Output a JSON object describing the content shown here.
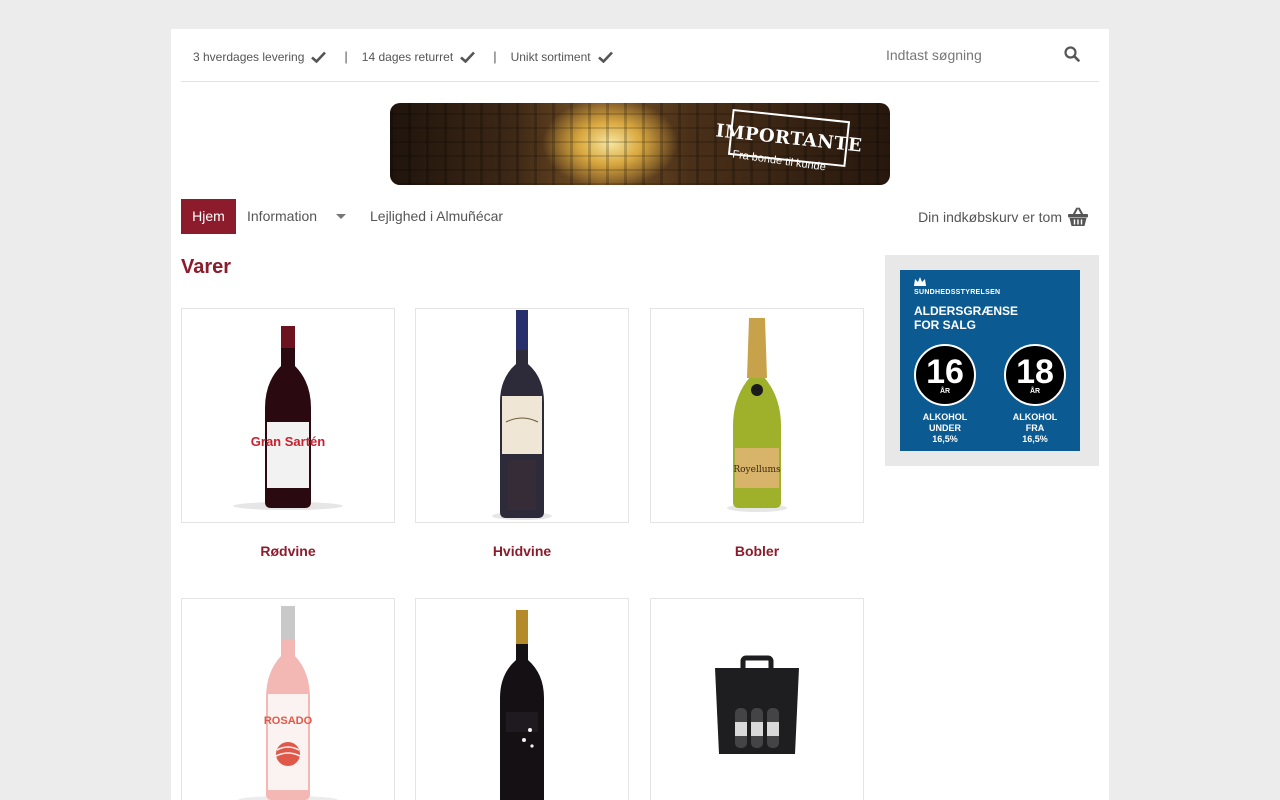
{
  "topbar": {
    "usps": [
      "3 hverdages levering",
      "14 dages returret",
      "Unikt sortiment"
    ],
    "search_placeholder": "Indtast søgning"
  },
  "banner": {
    "logo_title": "IMPORTANTE",
    "logo_subtitle": "Fra bonde til kunde"
  },
  "nav": {
    "home": "Hjem",
    "information": "Information",
    "apartment": "Lejlighed i Almuñécar",
    "cart": "Din indkøbskurv er tom"
  },
  "main": {
    "heading": "Varer",
    "products": [
      {
        "name": "Rødvine",
        "label": "Gran Sartén"
      },
      {
        "name": "Hvidvine",
        "label": ""
      },
      {
        "name": "Bobler",
        "label": "Royellums"
      },
      {
        "name": "",
        "label": "ROSADO"
      },
      {
        "name": "",
        "label": ""
      },
      {
        "name": "",
        "label": ""
      }
    ]
  },
  "sidebar": {
    "age_banner": {
      "org": "SUNDHEDSSTYRELSEN",
      "title_line1": "ALDERSGRÆNSE",
      "title_line2": "FOR SALG",
      "left_age": "16",
      "right_age": "18",
      "age_unit": "ÅR",
      "left_caption_1": "ALKOHOL",
      "left_caption_2": "UNDER",
      "left_caption_3": "16,5%",
      "right_caption_1": "ALKOHOL",
      "right_caption_2": "FRA",
      "right_caption_3": "16,5%"
    }
  },
  "colors": {
    "accent": "#8c1c2b",
    "background": "#ececec",
    "age_banner_blue": "#0c5a92"
  },
  "icons": [
    "check-icon",
    "search-icon",
    "caret-down-icon",
    "basket-icon"
  ]
}
